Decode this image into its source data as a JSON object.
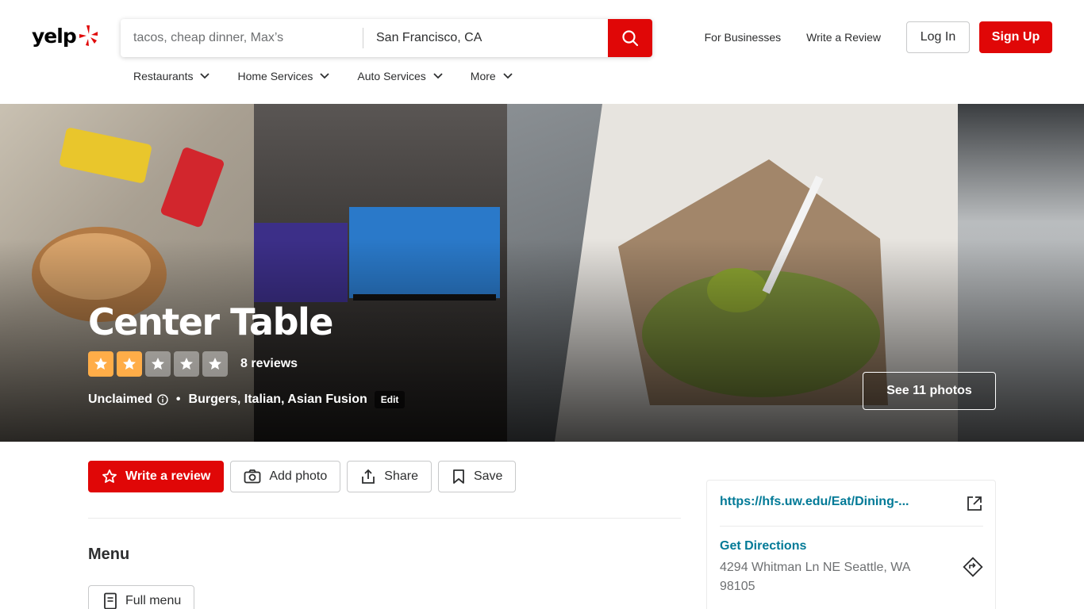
{
  "header": {
    "logo_text": "yelp",
    "search": {
      "find_placeholder": "tacos, cheap dinner, Max’s",
      "near_value": "San Francisco, CA"
    },
    "links": {
      "for_businesses": "For Businesses",
      "write_review": "Write a Review"
    },
    "login_label": "Log In",
    "signup_label": "Sign Up",
    "categories": [
      "Restaurants",
      "Home Services",
      "Auto Services",
      "More"
    ]
  },
  "hero": {
    "business_name": "Center Table",
    "rating": 2,
    "max_rating": 5,
    "review_count": "8 reviews",
    "claim_status": "Unclaimed",
    "categories_text": "Burgers, Italian, Asian Fusion",
    "edit_label": "Edit",
    "see_photos_label": "See 11 photos"
  },
  "actions": {
    "write_review": "Write a review",
    "add_photo": "Add photo",
    "share": "Share",
    "save": "Save"
  },
  "menu_section": {
    "title": "Menu",
    "full_menu_label": "Full menu"
  },
  "sidebar": {
    "website": "https://hfs.uw.edu/Eat/Dining-...",
    "directions_label": "Get Directions",
    "address": "4294 Whitman Ln NE Seattle, WA 98105"
  },
  "colors": {
    "brand_red": "#e00707",
    "star_orange": "#ffad48",
    "link_teal": "#027a97"
  }
}
